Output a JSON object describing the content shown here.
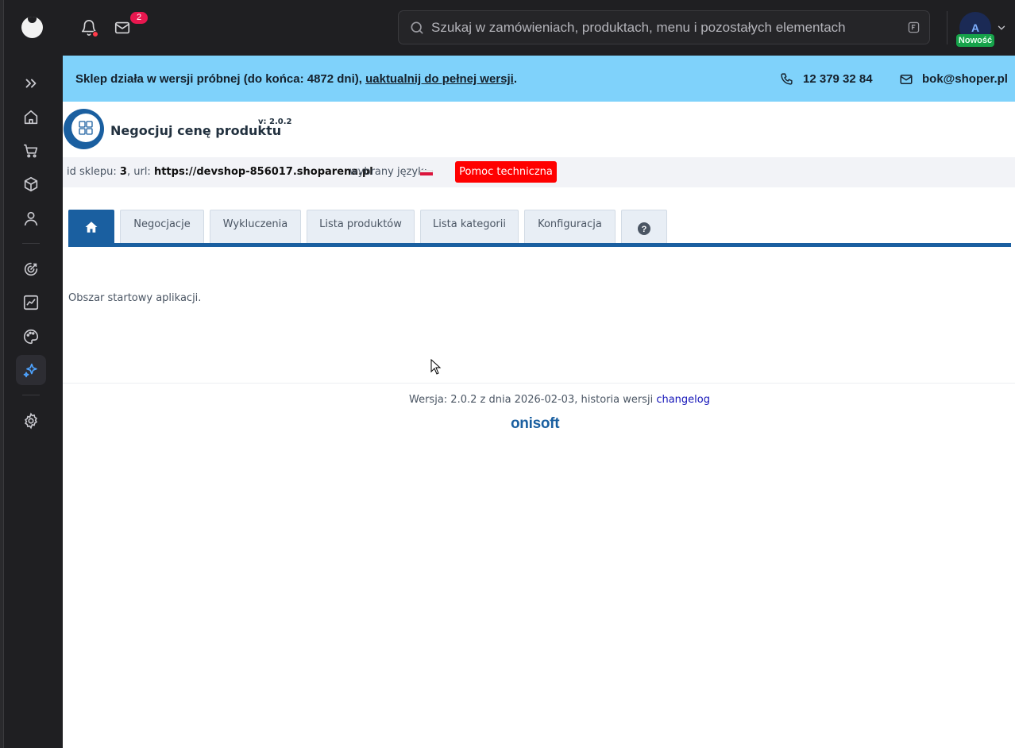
{
  "topbar": {
    "mail_badge": "2",
    "search_placeholder": "Szukaj w zamówieniach, produktach, menu i pozostałych elementach",
    "avatar_letter": "A",
    "new_badge": "Nowość"
  },
  "banner": {
    "text_prefix": "Sklep działa w wersji próbnej (do końca: 4872 dni), ",
    "link": "uaktualnij do pełnej wersji",
    "text_suffix": ".",
    "phone": "12 379 32 84",
    "email": "bok@shoper.pl"
  },
  "app": {
    "title": "Negocjuj cenę produktu",
    "version": "v: 2.0.2"
  },
  "info": {
    "shop_id_label": "id sklepu: ",
    "shop_id": "3",
    "url_label": ", url: ",
    "url": "https://devshop-856017.shoparena.pl",
    "language_label": "wybrany język:",
    "help_button": "Pomoc techniczna"
  },
  "tabs": [
    {
      "label": "",
      "icon": "home-icon"
    },
    {
      "label": "Negocjacje"
    },
    {
      "label": "Wykluczenia"
    },
    {
      "label": "Lista produktów"
    },
    {
      "label": "Lista kategorii"
    },
    {
      "label": "Konfiguracja"
    },
    {
      "label": "",
      "icon": "help-circle-icon"
    }
  ],
  "content": {
    "text": "Obszar startowy aplikacji."
  },
  "footer": {
    "text": "Wersja: 2.0.2 z dnia 2026-02-03, historia wersji ",
    "link": "changelog",
    "brand": "onisoft"
  },
  "colors": {
    "dark_bg": "#1f1f22",
    "banner": "#7fd2fb",
    "accent": "#1a5fa0",
    "help_button": "#ff0000",
    "badge": "#e8174f"
  }
}
